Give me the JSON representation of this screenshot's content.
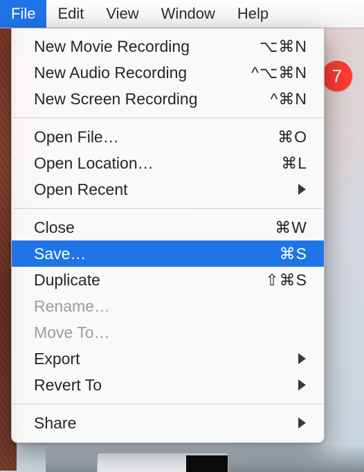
{
  "menubar": {
    "items": [
      {
        "label": "File",
        "active": true
      },
      {
        "label": "Edit",
        "active": false
      },
      {
        "label": "View",
        "active": false
      },
      {
        "label": "Window",
        "active": false
      },
      {
        "label": "Help",
        "active": false
      }
    ]
  },
  "badge": {
    "text": "7"
  },
  "file_menu": {
    "groups": [
      [
        {
          "label": "New Movie Recording",
          "shortcut": "⌥⌘N",
          "submenu": false,
          "disabled": false
        },
        {
          "label": "New Audio Recording",
          "shortcut": "^⌥⌘N",
          "submenu": false,
          "disabled": false
        },
        {
          "label": "New Screen Recording",
          "shortcut": "^⌘N",
          "submenu": false,
          "disabled": false
        }
      ],
      [
        {
          "label": "Open File…",
          "shortcut": "⌘O",
          "submenu": false,
          "disabled": false
        },
        {
          "label": "Open Location…",
          "shortcut": "⌘L",
          "submenu": false,
          "disabled": false
        },
        {
          "label": "Open Recent",
          "shortcut": "",
          "submenu": true,
          "disabled": false
        }
      ],
      [
        {
          "label": "Close",
          "shortcut": "⌘W",
          "submenu": false,
          "disabled": false
        },
        {
          "label": "Save…",
          "shortcut": "⌘S",
          "submenu": false,
          "disabled": false,
          "selected": true
        },
        {
          "label": "Duplicate",
          "shortcut": "⇧⌘S",
          "submenu": false,
          "disabled": false
        },
        {
          "label": "Rename…",
          "shortcut": "",
          "submenu": false,
          "disabled": true
        },
        {
          "label": "Move To…",
          "shortcut": "",
          "submenu": false,
          "disabled": true
        },
        {
          "label": "Export",
          "shortcut": "",
          "submenu": true,
          "disabled": false
        },
        {
          "label": "Revert To",
          "shortcut": "",
          "submenu": true,
          "disabled": false
        }
      ],
      [
        {
          "label": "Share",
          "shortcut": "",
          "submenu": true,
          "disabled": false
        }
      ]
    ]
  }
}
